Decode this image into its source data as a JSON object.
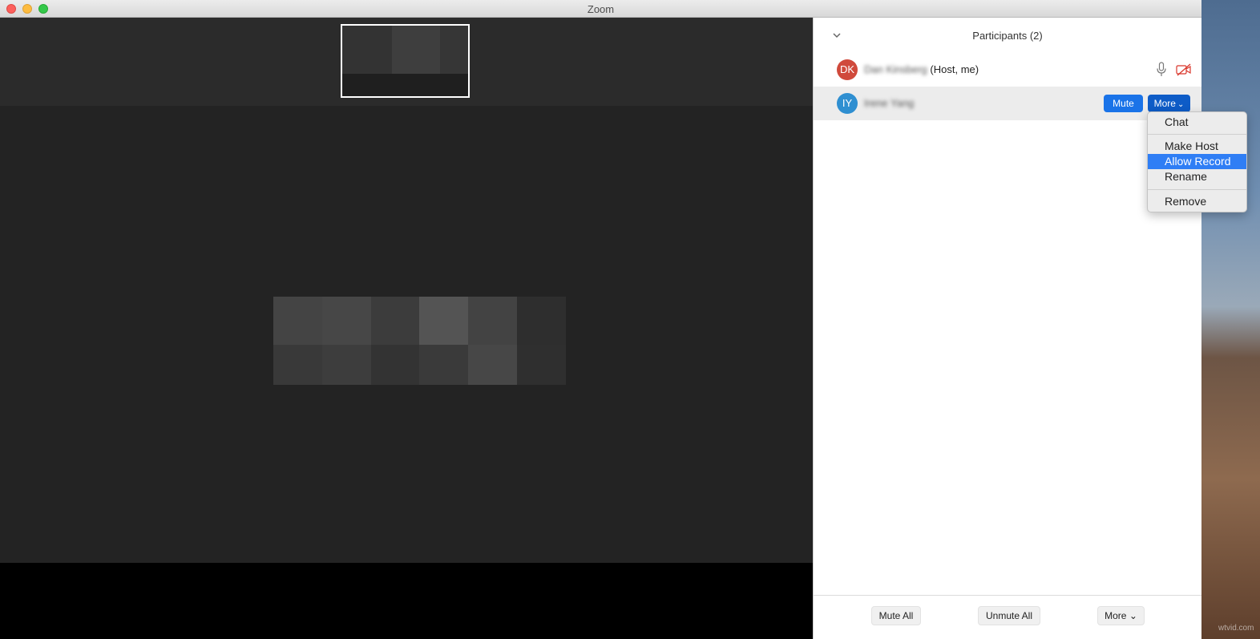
{
  "window": {
    "title": "Zoom"
  },
  "panel": {
    "title": "Participants (2)",
    "participants": [
      {
        "initials": "DK",
        "name": "Dan Kinsberg",
        "role": "(Host, me)",
        "avatar_color": "#d04a3c"
      },
      {
        "initials": "IY",
        "name": "Irene Yang",
        "avatar_color": "#2f8fd1",
        "mute_label": "Mute",
        "more_label": "More"
      }
    ]
  },
  "menu": {
    "items": [
      "Chat",
      "Make Host",
      "Allow Record",
      "Rename",
      "Remove"
    ],
    "selected": "Allow Record"
  },
  "footer": {
    "mute_all": "Mute All",
    "unmute_all": "Unmute All",
    "more": "More"
  },
  "watermark": "wtvid.com",
  "colors": {
    "accent": "#1a73e8",
    "menu_highlight": "#2f7ef5"
  }
}
